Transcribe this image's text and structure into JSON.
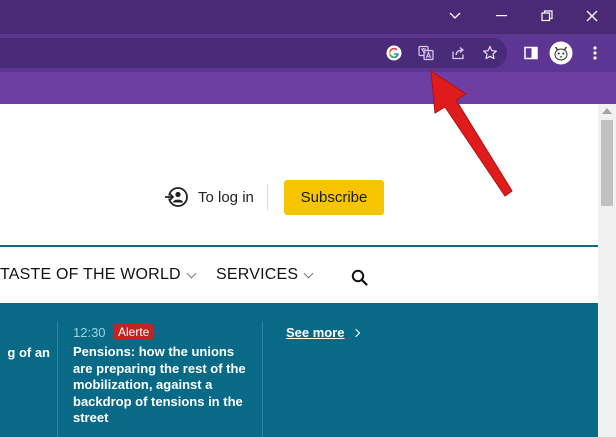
{
  "window": {
    "controls": [
      "minimize",
      "restore",
      "close"
    ]
  },
  "toolbar": {
    "omnibox_icons": [
      "google-icon",
      "translate-icon",
      "share-icon",
      "bookmark-star-icon"
    ],
    "right_icons": [
      "side-panel-icon",
      "profile-avatar",
      "menu-icon"
    ]
  },
  "header": {
    "login_label": "To log in",
    "subscribe_label": "Subscribe"
  },
  "nav": {
    "items": [
      {
        "label": "TASTE OF THE WORLD"
      },
      {
        "label": "SERVICES"
      }
    ]
  },
  "feed": {
    "truncated_text": "g of an",
    "item": {
      "time": "12:30",
      "badge": "Alerte",
      "headline": "Pensions: how the unions are preparing the rest of the mobilization, against a backdrop of tensions in the street"
    },
    "see_more_label": "See more"
  },
  "colors": {
    "titlebar": "#4a2a75",
    "toolbar": "#5d3593",
    "bookmarks_bar": "#6d3fa5",
    "subscribe_button": "#f6c500",
    "feed_background": "#086a86",
    "alert_badge": "#c42323",
    "annotation_arrow": "#e01b1b"
  }
}
